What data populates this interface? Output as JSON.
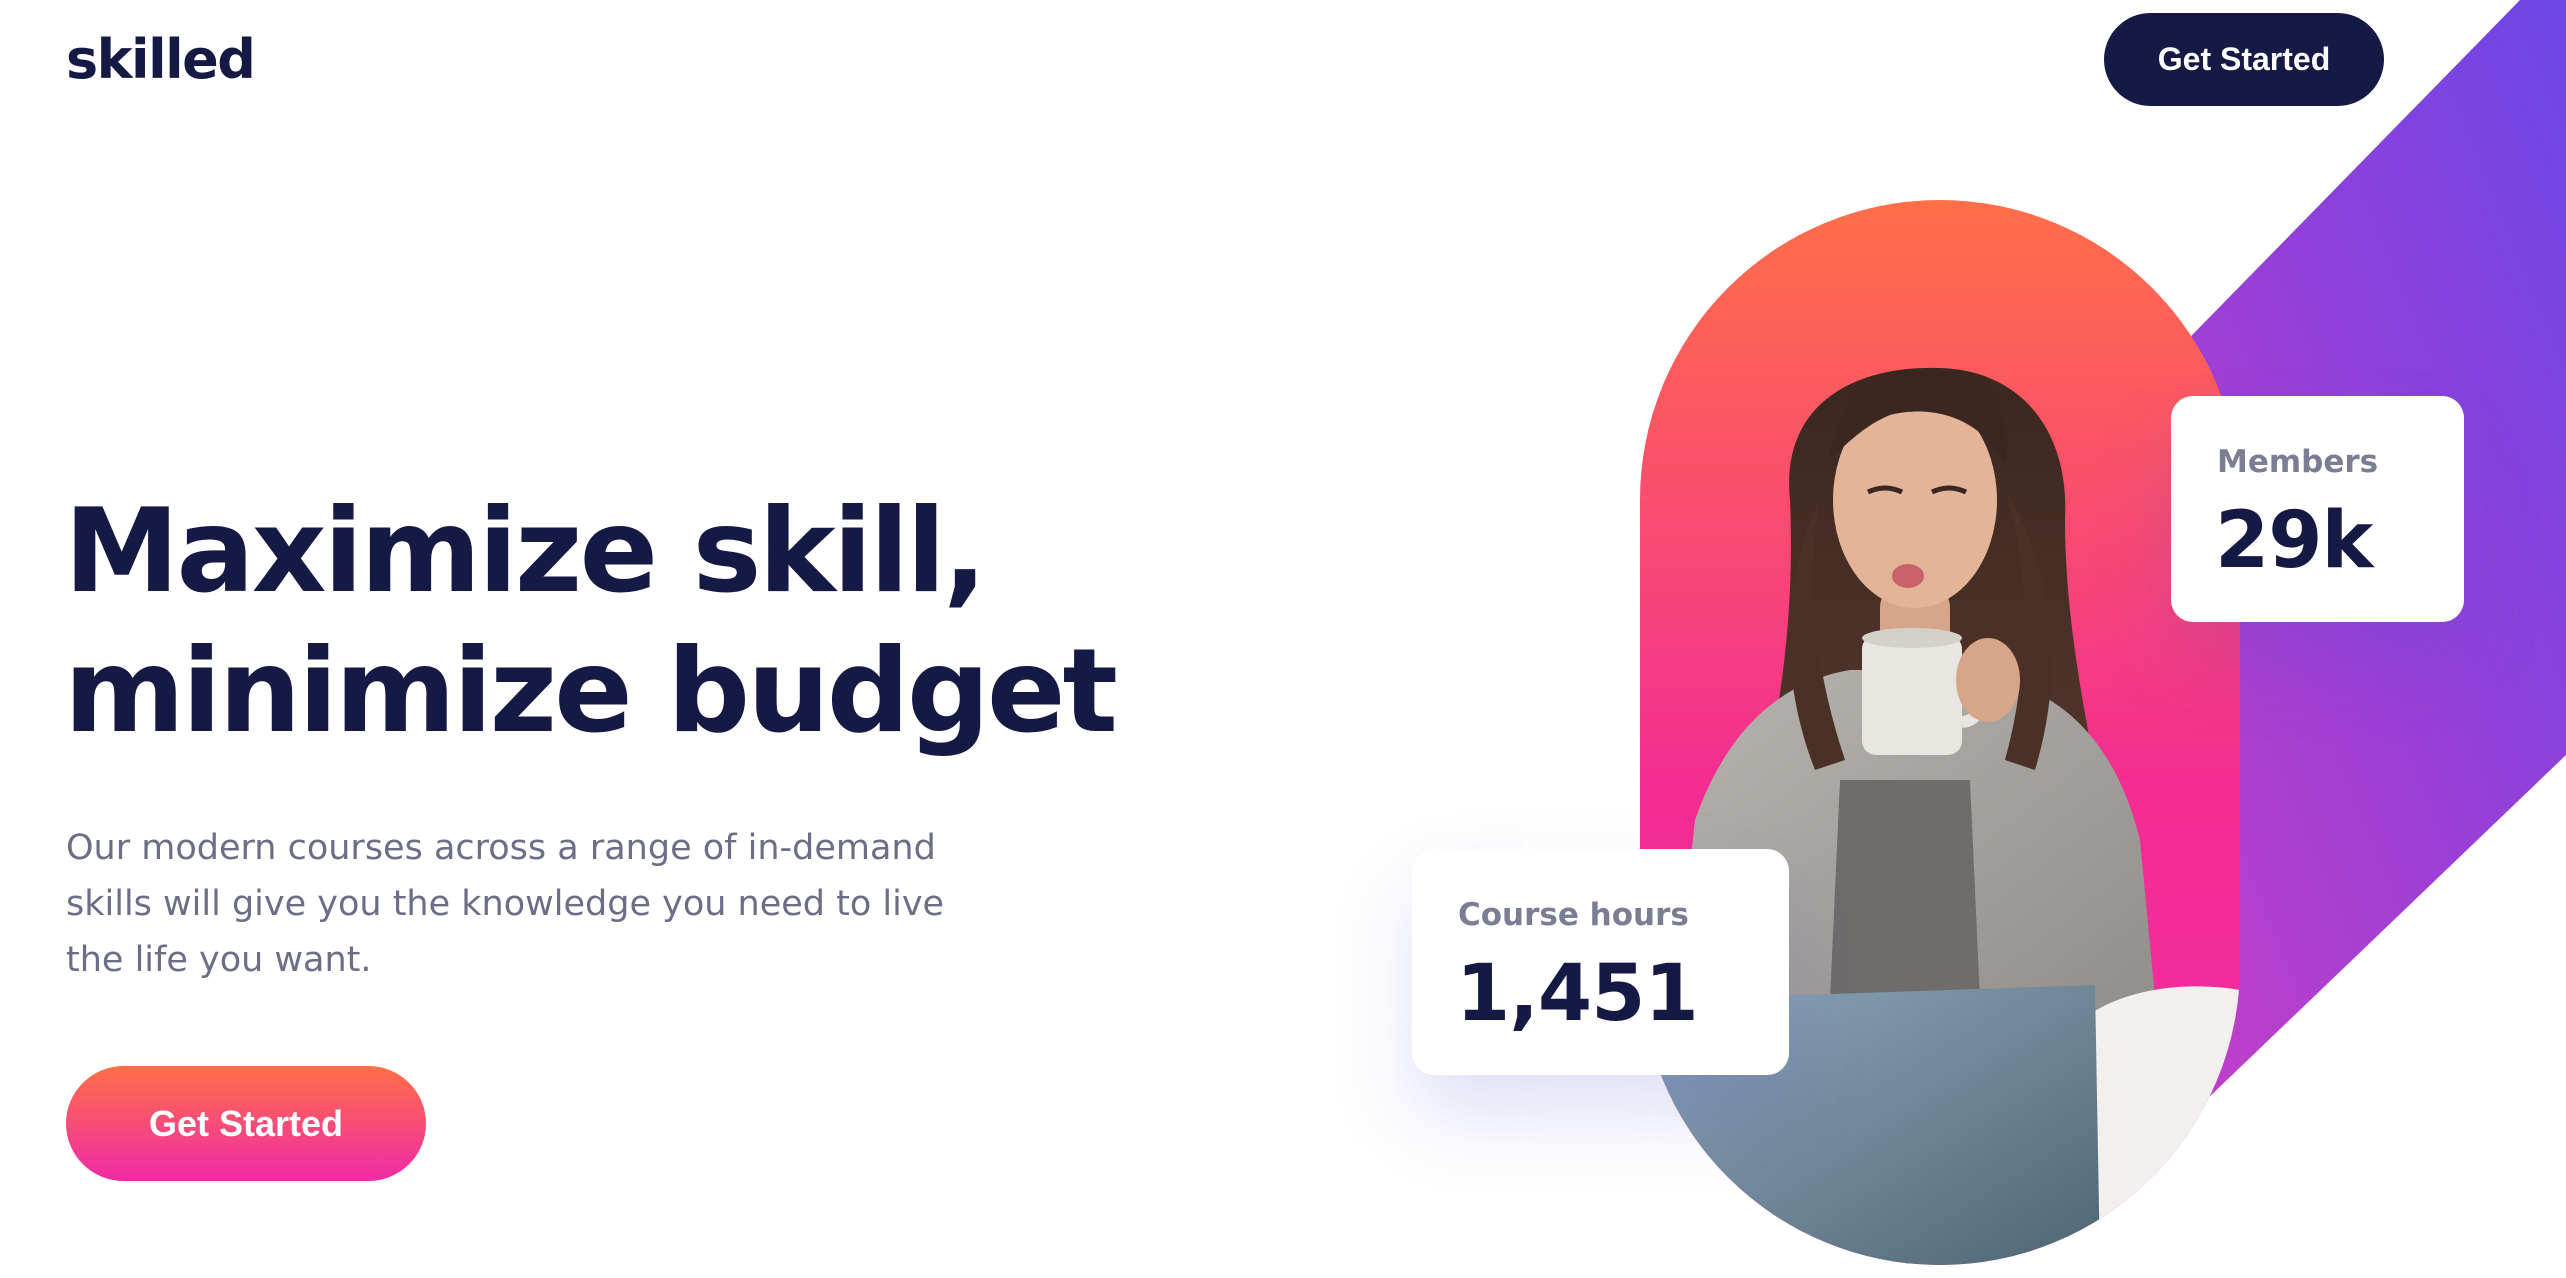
{
  "brand": {
    "logo_text": "skilled"
  },
  "header": {
    "cta_label": "Get Started"
  },
  "hero": {
    "title_line1": "Maximize skill,",
    "title_line2": "minimize budget",
    "description": "Our modern courses across a range of in-demand skills will give you the knowledge you need to live the life you want.",
    "cta_label": "Get Started"
  },
  "stats": {
    "members": {
      "label": "Members",
      "value": "29k"
    },
    "course_hours": {
      "label": "Course hours",
      "value": "1,451"
    }
  },
  "colors": {
    "navy": "#141a43",
    "text_gray": "#6b6f86",
    "orange": "#ff6f48",
    "pink": "#f02aa6",
    "purple": "#6c46e6"
  },
  "imagery": {
    "hero_photo": "woman-drinking-coffee-at-laptop"
  }
}
